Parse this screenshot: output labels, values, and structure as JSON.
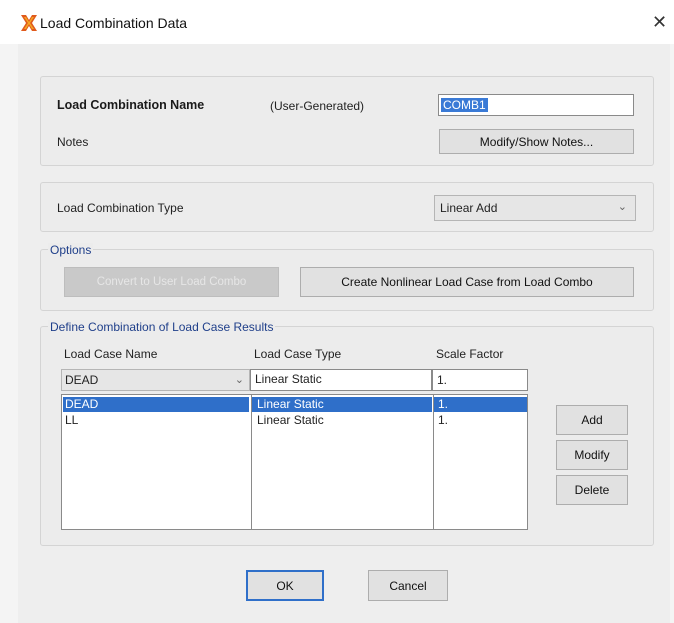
{
  "window": {
    "title": "Load Combination Data",
    "close_glyph": "✕",
    "icon": "app-logo-icon"
  },
  "combo_name": {
    "label": "Load Combination Name",
    "source": "(User-Generated)",
    "value": "COMB1"
  },
  "notes": {
    "label": "Notes",
    "button": "Modify/Show Notes..."
  },
  "combo_type": {
    "label": "Load Combination Type",
    "value": "Linear Add"
  },
  "options": {
    "legend": "Options",
    "convert_button": "Convert to User Load Combo",
    "create_button": "Create Nonlinear Load Case from Load Combo"
  },
  "define": {
    "legend": "Define Combination of Load Case Results",
    "headers": [
      "Load Case Name",
      "Load Case Type",
      "Scale Factor"
    ],
    "edit_row": {
      "name": "DEAD",
      "type": "Linear Static",
      "factor": "1."
    },
    "rows": [
      {
        "name": "DEAD",
        "type": "Linear Static",
        "factor": "1."
      },
      {
        "name": "LL",
        "type": "Linear Static",
        "factor": "1."
      }
    ],
    "add_button": "Add",
    "modify_button": "Modify",
    "delete_button": "Delete"
  },
  "footer": {
    "ok_button": "OK",
    "cancel_button": "Cancel"
  },
  "colors": {
    "accent": "#2f6fc9",
    "legend_text": "#1f3f8a"
  }
}
